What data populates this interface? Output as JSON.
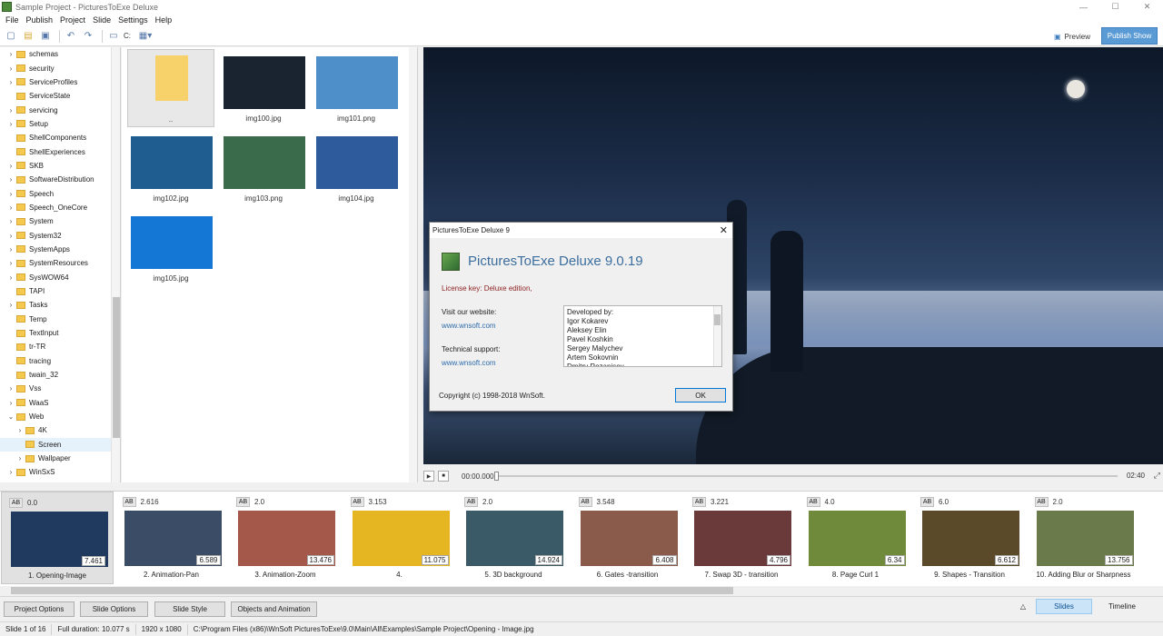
{
  "window": {
    "title": "Sample Project - PicturesToExe Deluxe"
  },
  "menu": [
    "File",
    "Publish",
    "Project",
    "Slide",
    "Settings",
    "Help"
  ],
  "toolbar": {
    "drive": "C:",
    "preview_label": "Preview",
    "publish_label": "Publish Show"
  },
  "tree": {
    "items": [
      {
        "label": "schemas",
        "expand": "›"
      },
      {
        "label": "security",
        "expand": "›"
      },
      {
        "label": "ServiceProfiles",
        "expand": "›"
      },
      {
        "label": "ServiceState",
        "expand": ""
      },
      {
        "label": "servicing",
        "expand": "›"
      },
      {
        "label": "Setup",
        "expand": "›"
      },
      {
        "label": "ShellComponents",
        "expand": ""
      },
      {
        "label": "ShellExperiences",
        "expand": ""
      },
      {
        "label": "SKB",
        "expand": "›"
      },
      {
        "label": "SoftwareDistribution",
        "expand": "›"
      },
      {
        "label": "Speech",
        "expand": "›"
      },
      {
        "label": "Speech_OneCore",
        "expand": "›"
      },
      {
        "label": "System",
        "expand": "›"
      },
      {
        "label": "System32",
        "expand": "›"
      },
      {
        "label": "SystemApps",
        "expand": "›"
      },
      {
        "label": "SystemResources",
        "expand": "›"
      },
      {
        "label": "SysWOW64",
        "expand": "›"
      },
      {
        "label": "TAPI",
        "expand": ""
      },
      {
        "label": "Tasks",
        "expand": "›"
      },
      {
        "label": "Temp",
        "expand": ""
      },
      {
        "label": "TextInput",
        "expand": ""
      },
      {
        "label": "tr-TR",
        "expand": ""
      },
      {
        "label": "tracing",
        "expand": ""
      },
      {
        "label": "twain_32",
        "expand": ""
      },
      {
        "label": "Vss",
        "expand": "›"
      },
      {
        "label": "WaaS",
        "expand": "›"
      },
      {
        "label": "Web",
        "expand": "⌄"
      },
      {
        "label": "4K",
        "expand": "›"
      },
      {
        "label": "Screen",
        "expand": ""
      },
      {
        "label": "Wallpaper",
        "expand": "›"
      },
      {
        "label": "WinSxS",
        "expand": "›"
      }
    ]
  },
  "files": [
    {
      "label": "..",
      "color": "#f7d26b"
    },
    {
      "label": "img100.jpg",
      "color": "#1a2430"
    },
    {
      "label": "img101.png",
      "color": "#4f8fc9"
    },
    {
      "label": "img102.jpg",
      "color": "#1f5c8f"
    },
    {
      "label": "img103.png",
      "color": "#3a6b4a"
    },
    {
      "label": "img104.jpg",
      "color": "#2e5b9c"
    },
    {
      "label": "img105.jpg",
      "color": "#1477d6"
    }
  ],
  "player": {
    "time": "00:00.000",
    "end": "02:40"
  },
  "slides": [
    {
      "dur": "0.0",
      "time": "7.461",
      "name": "1. Opening-Image",
      "color": "#1f3a5e"
    },
    {
      "dur": "2.616",
      "time": "6.589",
      "name": "2. Animation-Pan",
      "color": "#3b4d66"
    },
    {
      "dur": "2.0",
      "time": "13.476",
      "name": "3. Animation-Zoom",
      "color": "#a3584a"
    },
    {
      "dur": "3.153",
      "time": "11.075",
      "name": "4.",
      "color": "#e6b622"
    },
    {
      "dur": "2.0",
      "time": "14.924",
      "name": "5. 3D background",
      "color": "#3a5a68"
    },
    {
      "dur": "3.548",
      "time": "6.408",
      "name": "6. Gates -transition",
      "color": "#8a5a4a"
    },
    {
      "dur": "3.221",
      "time": "4.796",
      "name": "7. Swap 3D - transition",
      "color": "#6a3a3a"
    },
    {
      "dur": "4.0",
      "time": "6.34",
      "name": "8. Page Curl 1",
      "color": "#6f8a3a"
    },
    {
      "dur": "6.0",
      "time": "6.612",
      "name": "9. Shapes - Transition",
      "color": "#5a4a2a"
    },
    {
      "dur": "2.0",
      "time": "13.756",
      "name": "10. Adding Blur or Sharpness",
      "color": "#6a7a4a"
    }
  ],
  "slide_ab": "AB",
  "bottom": {
    "project_options": "Project Options",
    "slide_options": "Slide Options",
    "slide_style": "Slide Style",
    "objects_animation": "Objects and Animation",
    "slides_tab": "Slides",
    "timeline_tab": "Timeline"
  },
  "status": {
    "slide": "Slide 1 of 16",
    "duration": "Full duration: 10.077 s",
    "resolution": "1920 x 1080",
    "path": "C:\\Program Files (x86)\\WnSoft PicturesToExe\\9.0\\Main\\All\\Examples\\Sample Project\\Opening - Image.jpg"
  },
  "dialog": {
    "title": "PicturesToExe Deluxe 9",
    "app_name": "PicturesToExe Deluxe 9.0.19",
    "license": "License key: Deluxe edition,",
    "visit": "Visit our website:",
    "website": "www.wnsoft.com",
    "tech": "Technical support:",
    "support": "www.wnsoft.com",
    "credits": [
      "Developed by:",
      "Igor Kokarev",
      "Aleksey Elin",
      "Pavel Koshkin",
      "Sergey Malychev",
      "Artem Sokovnin",
      "Dmitry Rozanisev"
    ],
    "copyright": "Copyright (c) 1998-2018 WnSoft.",
    "ok": "OK"
  }
}
